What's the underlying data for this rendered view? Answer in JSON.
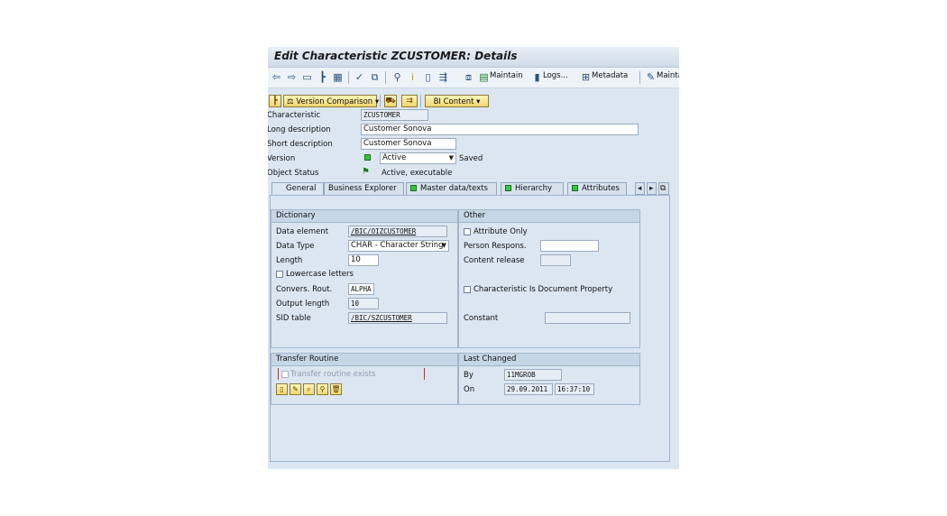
{
  "window": {
    "title": "Edit Characteristic ZCUSTOMER: Details"
  },
  "toolbar": {
    "maintain": "Maintain",
    "logs": "Logs...",
    "metadata": "Metadata",
    "maint_cut": "Mainta"
  },
  "appbar": {
    "version_comparison": "Version Comparison",
    "bi_content": "BI Content"
  },
  "header": {
    "characteristic_label": "Characteristic",
    "characteristic_value": "ZCUSTOMER",
    "long_desc_label": "Long description",
    "long_desc_value": "Customer Sonova",
    "short_desc_label": "Short description",
    "short_desc_value": "Customer Sonova",
    "version_label": "Version",
    "version_value": "Active",
    "version_saved": "Saved",
    "object_status_label": "Object Status",
    "object_status_value": "Active, executable"
  },
  "tabs": [
    "General",
    "Business Explorer",
    "Master data/texts",
    "Hierarchy",
    "Attributes"
  ],
  "dictionary": {
    "title": "Dictionary",
    "data_element_label": "Data element",
    "data_element_value": "/BIC/OIZCUSTOMER",
    "data_type_label": "Data Type",
    "data_type_value": "CHAR - Character String",
    "length_label": "Length",
    "length_value": "10",
    "lowercase_label": "Lowercase letters",
    "convers_label": "Convers. Rout.",
    "convers_value": "ALPHA",
    "output_length_label": "Output length",
    "output_length_value": "10",
    "sid_table_label": "SID table",
    "sid_table_value": "/BIC/SZCUSTOMER"
  },
  "other": {
    "title": "Other",
    "attribute_only_label": "Attribute Only",
    "person_respons_label": "Person Respons.",
    "content_release_label": "Content release",
    "doc_property_label": "Characteristic Is Document Property",
    "constant_label": "Constant"
  },
  "transfer": {
    "title": "Transfer Routine",
    "exists_label": "Transfer routine exists"
  },
  "last_changed": {
    "title": "Last Changed",
    "by_label": "By",
    "by_value": "11MGROB",
    "on_label": "On",
    "date_value": "29.09.2011",
    "time_value": "16:37:10"
  },
  "colors": {
    "led_green": "#35c83a",
    "button_yellow": "#f0d66e",
    "panel_bg": "#dbe6f1"
  }
}
